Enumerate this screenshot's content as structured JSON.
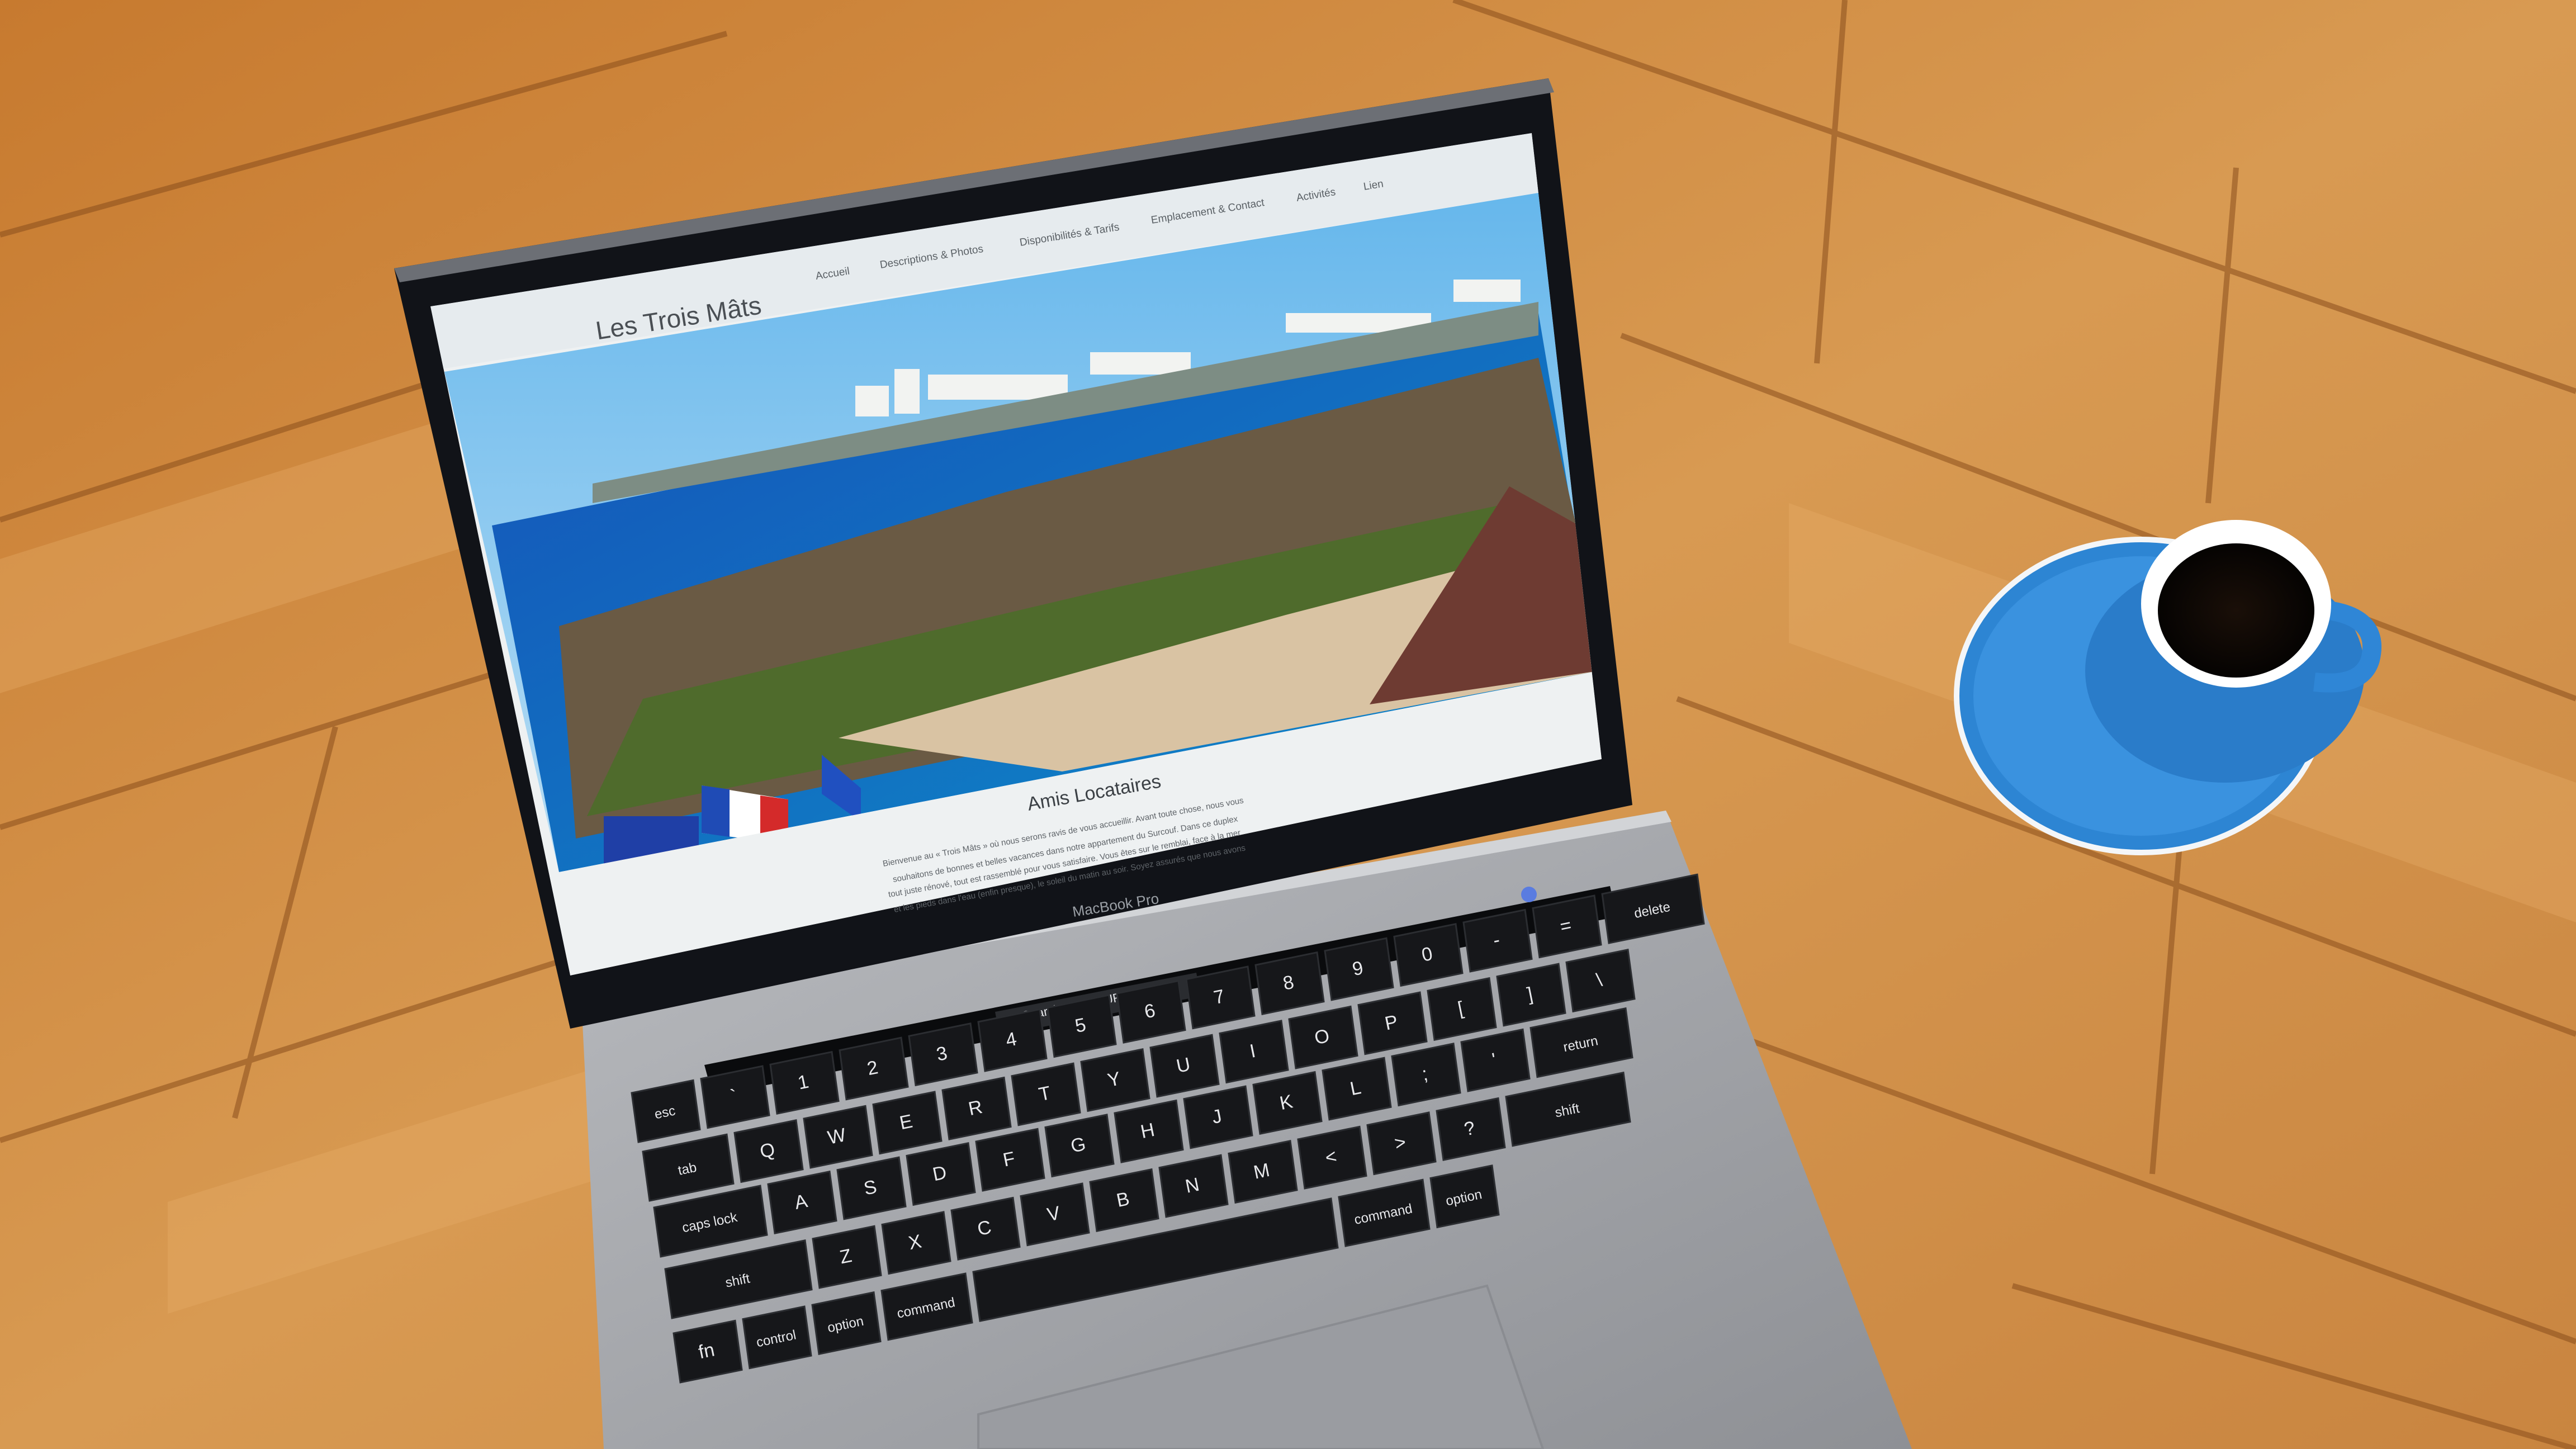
{
  "site": {
    "title": "Les Trois Mâts",
    "nav": [
      "Accueil",
      "Descriptions & Photos",
      "Disponibilités & Tarifs",
      "Emplacement & Contact",
      "Activités",
      "Lien"
    ],
    "heading": "Amis Locataires",
    "intro_lines": [
      "Bienvenue au « Trois Mâts » où nous serons ravis de vous accueillir. Avant toute chose, nous vous",
      "souhaitons de bonnes et belles vacances dans notre appartement du Surcouf. Dans ce duplex",
      "tout juste rénové, tout est rassemblé pour vous satisfaire. Vous êtes sur le remblai, face à la mer",
      "et les pieds dans l'eau (enfin presque), le soleil du matin au soir. Soyez assurés que nous avons"
    ]
  },
  "laptop": {
    "brand_label": "MacBook Pro",
    "touchbar_search": "Search or type URL"
  },
  "keyboard": {
    "rows": [
      [
        "esc",
        "`",
        "1",
        "2",
        "3",
        "4",
        "5",
        "6",
        "7",
        "8",
        "9",
        "0",
        "-",
        "=",
        "delete"
      ],
      [
        "tab",
        "Q",
        "W",
        "E",
        "R",
        "T",
        "Y",
        "U",
        "I",
        "O",
        "P",
        "[",
        "]",
        "\\"
      ],
      [
        "caps lock",
        "A",
        "S",
        "D",
        "F",
        "G",
        "H",
        "J",
        "K",
        "L",
        ";",
        "'",
        "return"
      ],
      [
        "shift",
        "Z",
        "X",
        "C",
        "V",
        "B",
        "N",
        "M",
        "<",
        ">",
        "?",
        "shift"
      ],
      [
        "fn",
        "control",
        "option",
        "command",
        "",
        "command",
        "option"
      ]
    ]
  },
  "colors": {
    "floor": "#d08a3e",
    "laptop_body": "#a9abb0",
    "bezel": "#111318",
    "screen_bg": "#eef1f2",
    "sea": "#1b63c9",
    "sky": "#8fcaf0",
    "cup": "#2f86d6"
  }
}
